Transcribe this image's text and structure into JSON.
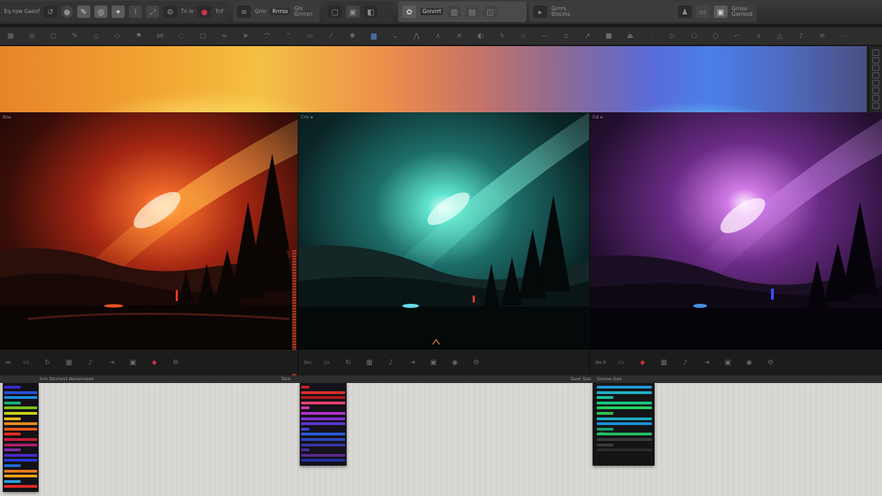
{
  "toolbar": {
    "left_label": "Eq nsw Gaonf",
    "g1_labels": [
      "Tn lo",
      "Tnf"
    ],
    "g2_label_a": "Grro",
    "g2_label_b": "Rrrrso",
    "g2_label_c": "Ghl",
    "g2_label_d": "Grrrrsn",
    "g4_label": "Gnnrrrt",
    "g5_label_a": "Grrrrs",
    "g5_label_b": "Stocms",
    "g5_label_c": "Grnoo",
    "g5_label_d": "Garrood"
  },
  "viewports": {
    "v1_tag": "Eno",
    "v2_tag": "Cro a",
    "v3_tag": "Cd o",
    "v1_ctrl_text": "oo",
    "v2_ctrl_text": "Grc",
    "v3_ctrl_text": "Oo 0"
  },
  "bottom": {
    "head_label_1": "Irrn Stnrnnrt Avnonneoo",
    "head_label_2": "Toro",
    "head_label_3": "Gvor Soo",
    "head_label_4": "Gnnne Goo",
    "s3_mark": "Ct"
  },
  "colors": {
    "gradient_left": "#e7832a",
    "gradient_mid": "#f4c043",
    "gradient_right": "#4b7fe8",
    "accent_record": "#c8324a"
  }
}
